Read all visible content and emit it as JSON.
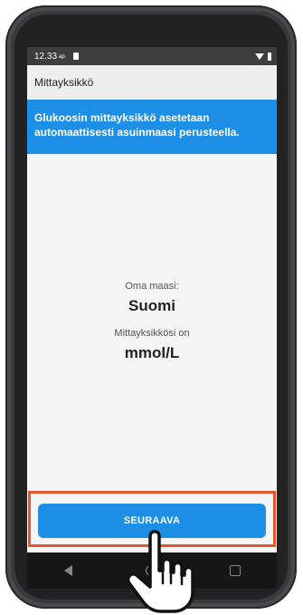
{
  "status_bar": {
    "time": "12.33",
    "ampm": "ap."
  },
  "header": {
    "title": "Mittayksikkö"
  },
  "banner": {
    "text": "Glukoosin mittayksikkö asetetaan automaattisesti asuinmaasi perusteella."
  },
  "info": {
    "country_label": "Oma maasi:",
    "country_value": "Suomi",
    "unit_label": "Mittayksikkösi on",
    "unit_value": "mmol/L"
  },
  "button": {
    "label": "SEURAAVA"
  },
  "colors": {
    "accent": "#1e8fe7",
    "highlight": "#e7552c"
  },
  "icons": [
    "sim-icon",
    "wifi-icon",
    "battery-icon",
    "back-icon",
    "home-icon",
    "recent-apps-icon",
    "pointing-hand-icon"
  ]
}
